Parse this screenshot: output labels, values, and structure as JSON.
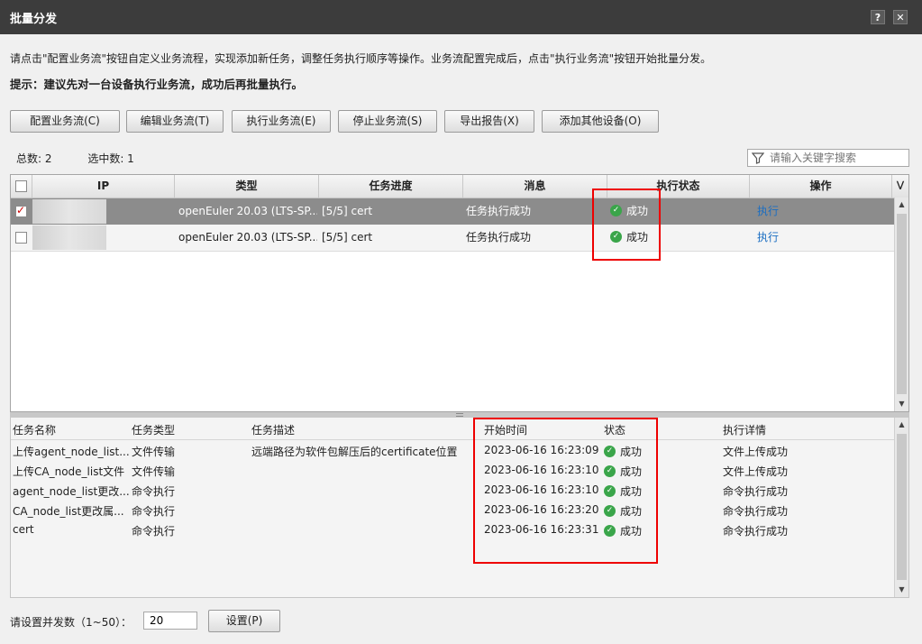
{
  "window": {
    "title": "批量分发",
    "help_label": "?",
    "close_label": "✕"
  },
  "description": "请点击\"配置业务流\"按钮自定义业务流程，实现添加新任务，调整任务执行顺序等操作。业务流配置完成后，点击\"执行业务流\"按钮开始批量分发。",
  "tip": "提示：建议先对一台设备执行业务流，成功后再批量执行。",
  "toolbar": {
    "configure": "配置业务流(C)",
    "edit": "编辑业务流(T)",
    "execute": "执行业务流(E)",
    "stop": "停止业务流(S)",
    "export": "导出报告(X)",
    "add_device": "添加其他设备(O)"
  },
  "counts": {
    "total": "总数: 2",
    "selected": "选中数: 1"
  },
  "search": {
    "placeholder": "请输入关键字搜索",
    "icon": "filter-icon"
  },
  "device_table": {
    "columns": [
      "IP",
      "类型",
      "任务进度",
      "消息",
      "执行状态",
      "操作"
    ],
    "rows": [
      {
        "selected": true,
        "ip": "",
        "type": "openEuler 20.03 (LTS-SP...",
        "progress": "[5/5] cert",
        "message": "任务执行成功",
        "status": "成功",
        "action": "执行"
      },
      {
        "selected": false,
        "ip": "",
        "type": "openEuler 20.03 (LTS-SP...",
        "progress": "[5/5] cert",
        "message": "任务执行成功",
        "status": "成功",
        "action": "执行"
      }
    ]
  },
  "task_table": {
    "columns": [
      "任务名称",
      "任务类型",
      "任务描述",
      "开始时间",
      "状态",
      "执行详情"
    ],
    "rows": [
      {
        "name": "上传agent_node_list...",
        "type": "文件传输",
        "desc": "远端路径为软件包解压后的certificate位置",
        "start": "2023-06-16 16:23:09",
        "status": "成功",
        "detail": "文件上传成功"
      },
      {
        "name": "上传CA_node_list文件",
        "type": "文件传输",
        "desc": "",
        "start": "2023-06-16 16:23:10",
        "status": "成功",
        "detail": "文件上传成功"
      },
      {
        "name": "agent_node_list更改...",
        "type": "命令执行",
        "desc": "",
        "start": "2023-06-16 16:23:10",
        "status": "成功",
        "detail": "命令执行成功"
      },
      {
        "name": "CA_node_list更改属...",
        "type": "命令执行",
        "desc": "",
        "start": "2023-06-16 16:23:20",
        "status": "成功",
        "detail": "命令执行成功"
      },
      {
        "name": "cert",
        "type": "命令执行",
        "desc": "",
        "start": "2023-06-16 16:23:31",
        "status": "成功",
        "detail": "命令执行成功"
      }
    ]
  },
  "concurrency": {
    "label": "请设置并发数（1~50）：",
    "value": "20",
    "set_label": "设置(P)"
  },
  "colors": {
    "titlebar": "#3c3c3c",
    "selected_row": "#8c8c8c",
    "success": "#3aa54a",
    "link": "#1b6ec2",
    "highlight": "#e00000"
  }
}
